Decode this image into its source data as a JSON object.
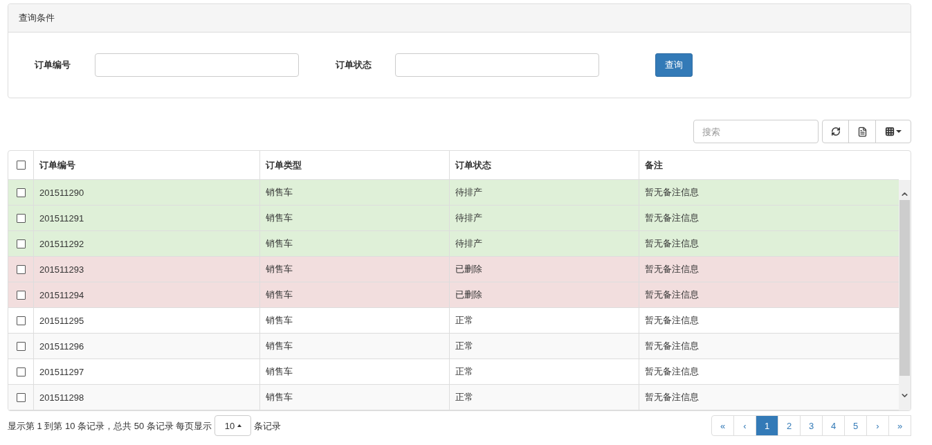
{
  "query_panel": {
    "title": "查询条件",
    "fields": [
      {
        "label": "订单编号"
      },
      {
        "label": "订单状态"
      }
    ],
    "button": "查询"
  },
  "toolbar": {
    "search": {
      "placeholder": "搜索"
    }
  },
  "table": {
    "select_all": {
      "checked": false
    },
    "columns": [
      "订单编号",
      "订单类型",
      "订单状态",
      "备注"
    ],
    "rows": [
      {
        "checked": false,
        "color": "#dff0d8",
        "cells": [
          "201511290",
          "销售车",
          "待排产",
          "暂无备注信息"
        ]
      },
      {
        "checked": false,
        "color": "#dff0d8",
        "cells": [
          "201511291",
          "销售车",
          "待排产",
          "暂无备注信息"
        ]
      },
      {
        "checked": false,
        "color": "#dff0d8",
        "cells": [
          "201511292",
          "销售车",
          "待排产",
          "暂无备注信息"
        ]
      },
      {
        "checked": false,
        "color": "#f2dede",
        "cells": [
          "201511293",
          "销售车",
          "已删除",
          "暂无备注信息"
        ]
      },
      {
        "checked": false,
        "color": "#f2dede",
        "cells": [
          "201511294",
          "销售车",
          "已删除",
          "暂无备注信息"
        ]
      },
      {
        "checked": false,
        "color": "#ffffff",
        "cells": [
          "201511295",
          "销售车",
          "正常",
          "暂无备注信息"
        ]
      },
      {
        "checked": false,
        "color": "#f9f9f9",
        "cells": [
          "201511296",
          "销售车",
          "正常",
          "暂无备注信息"
        ]
      },
      {
        "checked": false,
        "color": "#ffffff",
        "cells": [
          "201511297",
          "销售车",
          "正常",
          "暂无备注信息"
        ]
      },
      {
        "checked": false,
        "color": "#f9f9f9",
        "cells": [
          "201511298",
          "销售车",
          "正常",
          "暂无备注信息"
        ]
      }
    ]
  },
  "footer": {
    "summary_before": "显示第 1 到第 10 条记录，总共 50 条记录 每页显示",
    "page_size": "10",
    "summary_after": "条记录",
    "pages": [
      {
        "label": "«",
        "selected": false
      },
      {
        "label": "‹",
        "selected": false
      },
      {
        "label": "1",
        "selected": true
      },
      {
        "label": "2",
        "selected": false
      },
      {
        "label": "3",
        "selected": false
      },
      {
        "label": "4",
        "selected": false
      },
      {
        "label": "5",
        "selected": false
      },
      {
        "label": "›",
        "selected": false
      },
      {
        "label": "»",
        "selected": false
      }
    ]
  }
}
